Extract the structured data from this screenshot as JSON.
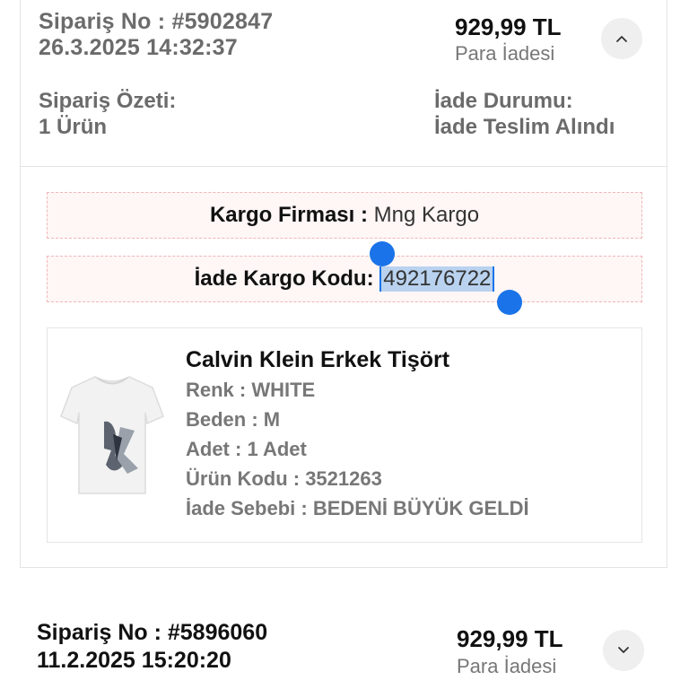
{
  "order1": {
    "order_no": "Sipariş No : #5902847",
    "date": "26.3.2025 14:32:37",
    "amount": "929,99 TL",
    "amount_label": "Para İadesi",
    "summary_label": "Sipariş Özeti:",
    "summary_value": "1 Ürün",
    "status_label": "İade Durumu:",
    "status_value": "İade Teslim Alındı",
    "toggle_icon": "chevron-up-icon",
    "cargo_company_label": "Kargo Firması :",
    "cargo_company_value": "Mng Kargo",
    "return_code_label": "İade Kargo Kodu:",
    "return_code_value": "492176722",
    "product": {
      "name": "Calvin Klein Erkek Tişört",
      "color": "Renk : WHITE",
      "size": "Beden : M",
      "quantity": "Adet : 1 Adet",
      "code": "Ürün Kodu : 3521263",
      "reason": "İade Sebebi : BEDENİ BÜYÜK GELDİ"
    }
  },
  "order2": {
    "order_no": "Sipariş No : #5896060",
    "date": "11.2.2025 15:20:20",
    "amount": "929,99 TL",
    "amount_label": "Para İadesi",
    "toggle_icon": "chevron-down-icon"
  },
  "colors": {
    "selection": "#b9d2ef",
    "selection_handle": "#1a73e8",
    "dashed_border": "#f0b7b7",
    "dashed_bg": "#fff6f6"
  }
}
